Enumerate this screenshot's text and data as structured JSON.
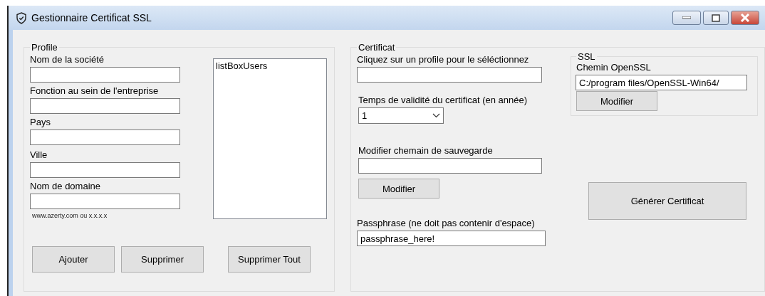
{
  "window": {
    "title": "Gestionnaire Certificat SSL"
  },
  "profile": {
    "title": "Profile",
    "fields": [
      {
        "label": "Nom de la société"
      },
      {
        "label": "Fonction au sein de l'entreprise"
      },
      {
        "label": "Pays"
      },
      {
        "label": "Ville"
      },
      {
        "label": "Nom de domaine"
      }
    ],
    "hint": "www.azerty.com ou x.x.x.x",
    "listbox": {
      "items": [
        "listBoxUsers"
      ]
    },
    "buttons": [
      "Ajouter",
      "Supprimer",
      "Supprimer Tout"
    ]
  },
  "certificat": {
    "title": "Certificat",
    "select_label": "Cliquez sur un profile pour le séléctionnez",
    "validity_label": "Temps de validité du certificat (en année)",
    "validity_value": "1",
    "path_label": "Modifier chemain de sauvegarde",
    "path_button": "Modifier",
    "passphrase_label": "Passphrase (ne doit pas contenir d'espace)",
    "passphrase_value": "passphrase_here!",
    "ssl": {
      "title": "SSL",
      "label": "Chemin OpenSSL",
      "value": "C:/program files/OpenSSL-Win64/",
      "button": "Modifier"
    },
    "generate_button": "Générer Certificat"
  }
}
